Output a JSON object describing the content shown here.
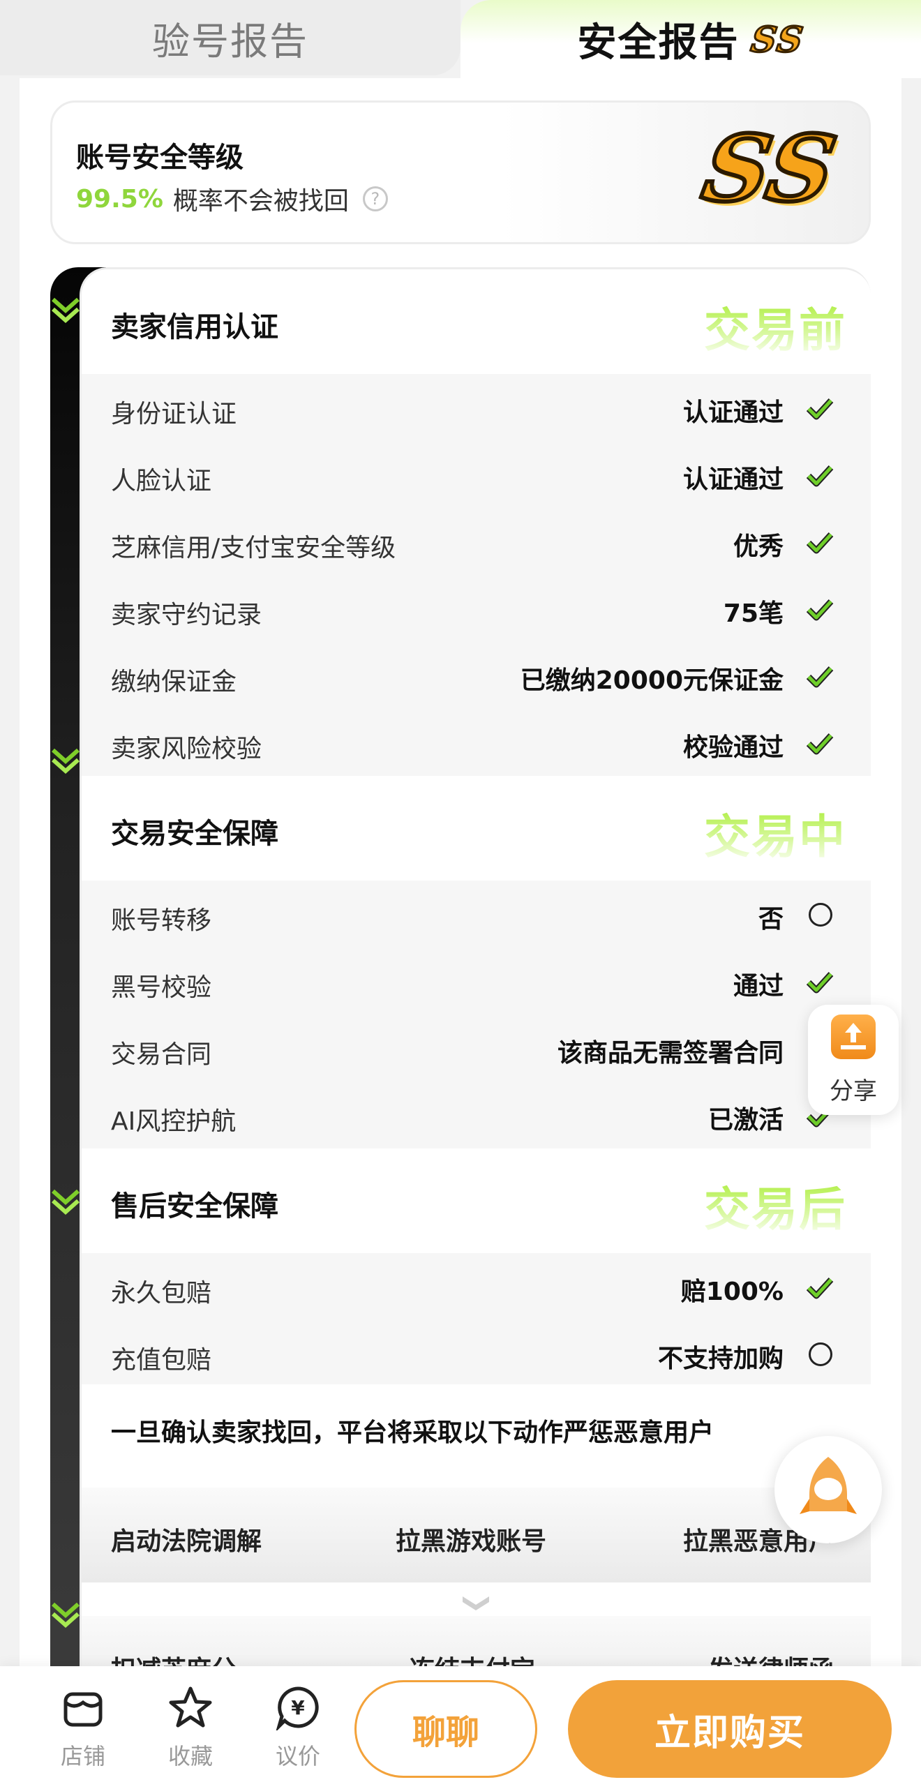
{
  "tabs": {
    "inspection": "验号报告",
    "security": "安全报告",
    "security_badge": "SS"
  },
  "level_card": {
    "title": "账号安全等级",
    "percent": "99.5%",
    "subtitle": "概率不会被找回",
    "help_icon": "?",
    "badge": "SS"
  },
  "sections": {
    "before": {
      "title": "卖家信用认证",
      "stage": "交易前",
      "rows": [
        {
          "label": "身份证认证",
          "value": "认证通过",
          "status": "check"
        },
        {
          "label": "人脸认证",
          "value": "认证通过",
          "status": "check"
        },
        {
          "label": "芝麻信用/支付宝安全等级",
          "value": "优秀",
          "status": "check"
        },
        {
          "label": "卖家守约记录",
          "value": "75笔",
          "status": "check"
        },
        {
          "label": "缴纳保证金",
          "value": "已缴纳20000元保证金",
          "status": "check"
        },
        {
          "label": "卖家风险校验",
          "value": "校验通过",
          "status": "check"
        }
      ]
    },
    "during": {
      "title": "交易安全保障",
      "stage": "交易中",
      "rows": [
        {
          "label": "账号转移",
          "value": "否",
          "status": "circle"
        },
        {
          "label": "黑号校验",
          "value": "通过",
          "status": "check"
        },
        {
          "label": "交易合同",
          "value": "该商品无需签署合同",
          "status": "circle"
        },
        {
          "label": "AI风控护航",
          "value": "已激活",
          "status": "check"
        }
      ]
    },
    "after": {
      "title": "售后安全保障",
      "stage": "交易后",
      "rows": [
        {
          "label": "永久包赔",
          "value": "赔100%",
          "status": "check"
        },
        {
          "label": "充值包赔",
          "value": "不支持加购",
          "status": "circle"
        }
      ]
    }
  },
  "notice": {
    "text": "一旦确认卖家找回，平台将采取以下动作严惩恶意用户",
    "actions_row1": [
      "启动法院调解",
      "拉黑游戏账号",
      "拉黑恶意用户"
    ],
    "actions_row2": [
      "扣减芝麻分",
      "冻结支付宝",
      "发送律师函"
    ]
  },
  "share": {
    "label": "分享",
    "icon": "share-icon"
  },
  "bottom_bar": {
    "shop": "店铺",
    "favorite": "收藏",
    "bargain": "议价",
    "chat": "聊聊",
    "buy": "立即购买"
  },
  "colors": {
    "accent_green": "#8fd63c",
    "accent_orange": "#f2a23a",
    "check_green": "#6fcf2a"
  }
}
